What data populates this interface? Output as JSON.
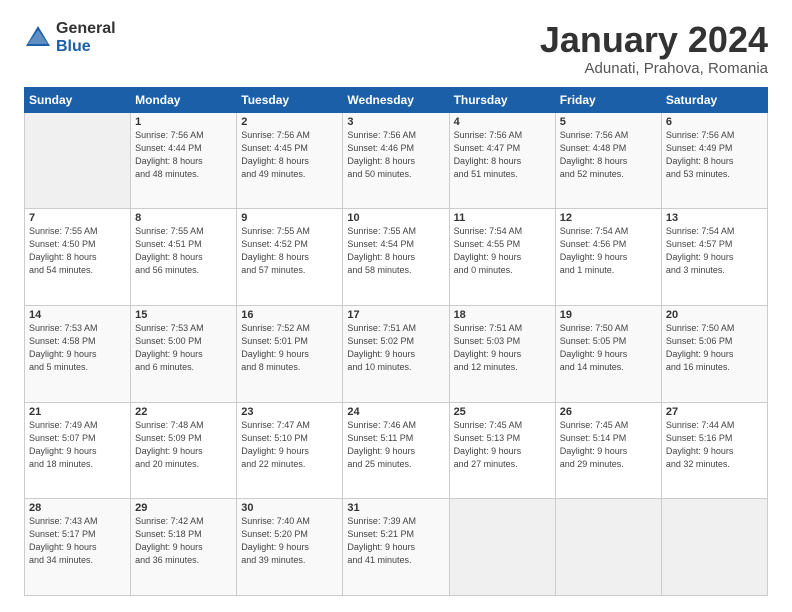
{
  "header": {
    "logo_general": "General",
    "logo_blue": "Blue",
    "month_title": "January 2024",
    "subtitle": "Adunati, Prahova, Romania"
  },
  "weekdays": [
    "Sunday",
    "Monday",
    "Tuesday",
    "Wednesday",
    "Thursday",
    "Friday",
    "Saturday"
  ],
  "weeks": [
    [
      {
        "day": "",
        "sunrise": "",
        "sunset": "",
        "daylight": "",
        "empty": true
      },
      {
        "day": "1",
        "sunrise": "Sunrise: 7:56 AM",
        "sunset": "Sunset: 4:44 PM",
        "daylight": "Daylight: 8 hours and 48 minutes."
      },
      {
        "day": "2",
        "sunrise": "Sunrise: 7:56 AM",
        "sunset": "Sunset: 4:45 PM",
        "daylight": "Daylight: 8 hours and 49 minutes."
      },
      {
        "day": "3",
        "sunrise": "Sunrise: 7:56 AM",
        "sunset": "Sunset: 4:46 PM",
        "daylight": "Daylight: 8 hours and 50 minutes."
      },
      {
        "day": "4",
        "sunrise": "Sunrise: 7:56 AM",
        "sunset": "Sunset: 4:47 PM",
        "daylight": "Daylight: 8 hours and 51 minutes."
      },
      {
        "day": "5",
        "sunrise": "Sunrise: 7:56 AM",
        "sunset": "Sunset: 4:48 PM",
        "daylight": "Daylight: 8 hours and 52 minutes."
      },
      {
        "day": "6",
        "sunrise": "Sunrise: 7:56 AM",
        "sunset": "Sunset: 4:49 PM",
        "daylight": "Daylight: 8 hours and 53 minutes."
      }
    ],
    [
      {
        "day": "7",
        "sunrise": "Sunrise: 7:55 AM",
        "sunset": "Sunset: 4:50 PM",
        "daylight": "Daylight: 8 hours and 54 minutes."
      },
      {
        "day": "8",
        "sunrise": "Sunrise: 7:55 AM",
        "sunset": "Sunset: 4:51 PM",
        "daylight": "Daylight: 8 hours and 56 minutes."
      },
      {
        "day": "9",
        "sunrise": "Sunrise: 7:55 AM",
        "sunset": "Sunset: 4:52 PM",
        "daylight": "Daylight: 8 hours and 57 minutes."
      },
      {
        "day": "10",
        "sunrise": "Sunrise: 7:55 AM",
        "sunset": "Sunset: 4:54 PM",
        "daylight": "Daylight: 8 hours and 58 minutes."
      },
      {
        "day": "11",
        "sunrise": "Sunrise: 7:54 AM",
        "sunset": "Sunset: 4:55 PM",
        "daylight": "Daylight: 9 hours and 0 minutes."
      },
      {
        "day": "12",
        "sunrise": "Sunrise: 7:54 AM",
        "sunset": "Sunset: 4:56 PM",
        "daylight": "Daylight: 9 hours and 1 minute."
      },
      {
        "day": "13",
        "sunrise": "Sunrise: 7:54 AM",
        "sunset": "Sunset: 4:57 PM",
        "daylight": "Daylight: 9 hours and 3 minutes."
      }
    ],
    [
      {
        "day": "14",
        "sunrise": "Sunrise: 7:53 AM",
        "sunset": "Sunset: 4:58 PM",
        "daylight": "Daylight: 9 hours and 5 minutes."
      },
      {
        "day": "15",
        "sunrise": "Sunrise: 7:53 AM",
        "sunset": "Sunset: 5:00 PM",
        "daylight": "Daylight: 9 hours and 6 minutes."
      },
      {
        "day": "16",
        "sunrise": "Sunrise: 7:52 AM",
        "sunset": "Sunset: 5:01 PM",
        "daylight": "Daylight: 9 hours and 8 minutes."
      },
      {
        "day": "17",
        "sunrise": "Sunrise: 7:51 AM",
        "sunset": "Sunset: 5:02 PM",
        "daylight": "Daylight: 9 hours and 10 minutes."
      },
      {
        "day": "18",
        "sunrise": "Sunrise: 7:51 AM",
        "sunset": "Sunset: 5:03 PM",
        "daylight": "Daylight: 9 hours and 12 minutes."
      },
      {
        "day": "19",
        "sunrise": "Sunrise: 7:50 AM",
        "sunset": "Sunset: 5:05 PM",
        "daylight": "Daylight: 9 hours and 14 minutes."
      },
      {
        "day": "20",
        "sunrise": "Sunrise: 7:50 AM",
        "sunset": "Sunset: 5:06 PM",
        "daylight": "Daylight: 9 hours and 16 minutes."
      }
    ],
    [
      {
        "day": "21",
        "sunrise": "Sunrise: 7:49 AM",
        "sunset": "Sunset: 5:07 PM",
        "daylight": "Daylight: 9 hours and 18 minutes."
      },
      {
        "day": "22",
        "sunrise": "Sunrise: 7:48 AM",
        "sunset": "Sunset: 5:09 PM",
        "daylight": "Daylight: 9 hours and 20 minutes."
      },
      {
        "day": "23",
        "sunrise": "Sunrise: 7:47 AM",
        "sunset": "Sunset: 5:10 PM",
        "daylight": "Daylight: 9 hours and 22 minutes."
      },
      {
        "day": "24",
        "sunrise": "Sunrise: 7:46 AM",
        "sunset": "Sunset: 5:11 PM",
        "daylight": "Daylight: 9 hours and 25 minutes."
      },
      {
        "day": "25",
        "sunrise": "Sunrise: 7:45 AM",
        "sunset": "Sunset: 5:13 PM",
        "daylight": "Daylight: 9 hours and 27 minutes."
      },
      {
        "day": "26",
        "sunrise": "Sunrise: 7:45 AM",
        "sunset": "Sunset: 5:14 PM",
        "daylight": "Daylight: 9 hours and 29 minutes."
      },
      {
        "day": "27",
        "sunrise": "Sunrise: 7:44 AM",
        "sunset": "Sunset: 5:16 PM",
        "daylight": "Daylight: 9 hours and 32 minutes."
      }
    ],
    [
      {
        "day": "28",
        "sunrise": "Sunrise: 7:43 AM",
        "sunset": "Sunset: 5:17 PM",
        "daylight": "Daylight: 9 hours and 34 minutes."
      },
      {
        "day": "29",
        "sunrise": "Sunrise: 7:42 AM",
        "sunset": "Sunset: 5:18 PM",
        "daylight": "Daylight: 9 hours and 36 minutes."
      },
      {
        "day": "30",
        "sunrise": "Sunrise: 7:40 AM",
        "sunset": "Sunset: 5:20 PM",
        "daylight": "Daylight: 9 hours and 39 minutes."
      },
      {
        "day": "31",
        "sunrise": "Sunrise: 7:39 AM",
        "sunset": "Sunset: 5:21 PM",
        "daylight": "Daylight: 9 hours and 41 minutes."
      },
      {
        "day": "",
        "sunrise": "",
        "sunset": "",
        "daylight": "",
        "empty": true
      },
      {
        "day": "",
        "sunrise": "",
        "sunset": "",
        "daylight": "",
        "empty": true
      },
      {
        "day": "",
        "sunrise": "",
        "sunset": "",
        "daylight": "",
        "empty": true
      }
    ]
  ]
}
